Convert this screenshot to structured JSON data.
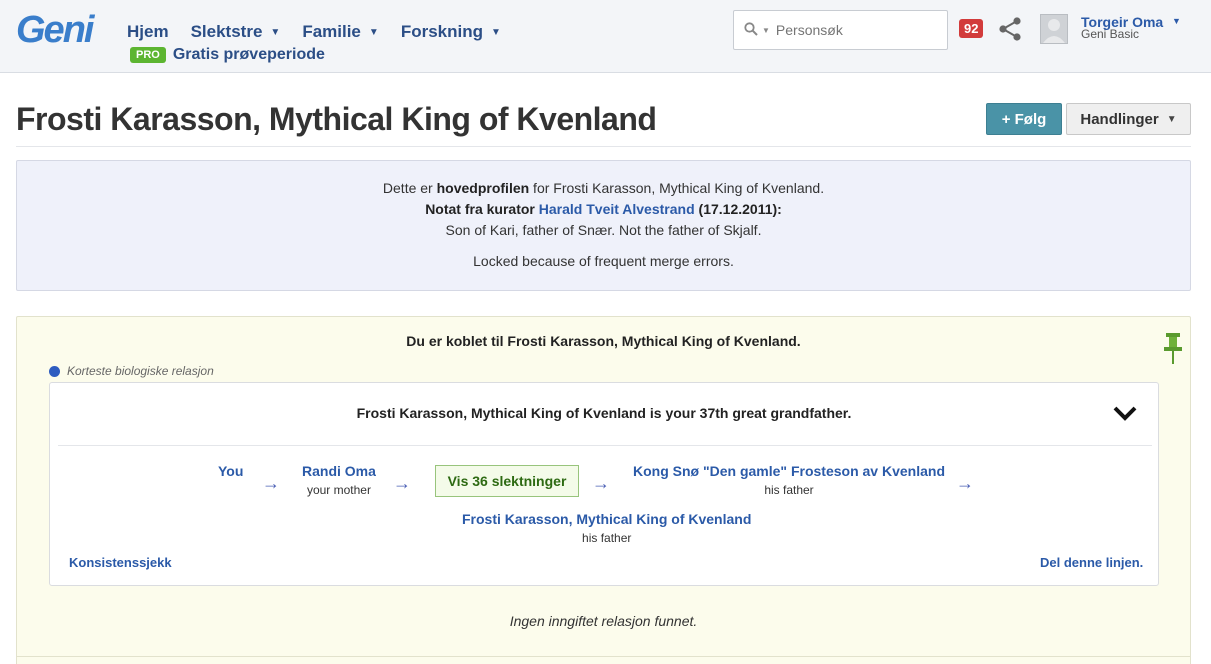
{
  "header": {
    "logo": "Geni",
    "nav": [
      {
        "label": "Hjem",
        "dropdown": false
      },
      {
        "label": "Slektstre",
        "dropdown": true
      },
      {
        "label": "Familie",
        "dropdown": true
      },
      {
        "label": "Forskning",
        "dropdown": true
      }
    ],
    "pro_badge": "PRO",
    "pro_link": "Gratis prøveperiode",
    "search_placeholder": "Personsøk",
    "notification_count": "92",
    "user_name": "Torgeir Oma",
    "user_plan": "Geni Basic"
  },
  "profile": {
    "title": "Frosti Karasson, Mythical King of Kvenland",
    "follow_label": "+ Følg",
    "actions_label": "Handlinger"
  },
  "info": {
    "line1_pre": "Dette er ",
    "line1_bold": "hovedprofilen",
    "line1_post": " for Frosti Karasson, Mythical King of Kvenland.",
    "note_label": "Notat fra kurator ",
    "curator": "Harald Tveit Alvestrand",
    "note_date": " (17.12.2011):",
    "note_text": "Son of Kari, father of Snær. Not the father of Skjalf.",
    "lock_text": "Locked because of frequent merge errors."
  },
  "relation": {
    "heading": "Du er koblet til Frosti Karasson, Mythical King of Kvenland.",
    "legend": "Korteste biologiske relasjon",
    "summary": "Frosti Karasson, Mythical King of Kvenland is your 37th great grandfather.",
    "path": [
      {
        "name": "You",
        "relation": ""
      },
      {
        "name": "Randi Oma",
        "relation": "your mother"
      },
      {
        "name": "Kong Snø \"Den gamle\" Frosteson av Kvenland",
        "relation": "his father"
      },
      {
        "name": "Frosti Karasson, Mythical King of Kvenland",
        "relation": "his father"
      }
    ],
    "arrow": "→",
    "expand_label": "Vis 36 slektninger",
    "consistency_link": "Konsistenssjekk",
    "share_link": "Del denne linjen.",
    "no_marriage": "Ingen inngiftet relasjon funnet."
  }
}
